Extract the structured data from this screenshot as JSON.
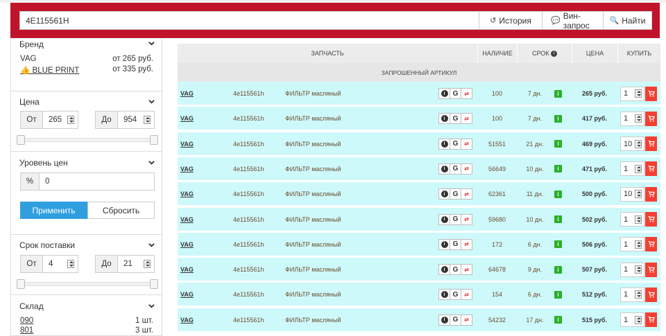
{
  "search": {
    "value": "4E115561H",
    "history": "История",
    "vin": "Вин-запрос",
    "find": "Найти"
  },
  "filters": {
    "brand": {
      "title": "Бренд",
      "items": [
        {
          "name": "VAG",
          "price": "от 265 руб."
        },
        {
          "name": "BLUE PRINT",
          "price": "от 335 руб."
        }
      ]
    },
    "price": {
      "title": "Цена",
      "from_label": "От",
      "from": "265",
      "to_label": "До",
      "to": "954"
    },
    "level": {
      "title": "Уровень цен",
      "pct_label": "%",
      "value": "0",
      "apply": "Применить",
      "reset": "Сбросить"
    },
    "delivery": {
      "title": "Срок поставки",
      "from_label": "От",
      "from": "4",
      "to_label": "До",
      "to": "21"
    },
    "warehouse": {
      "title": "Склад",
      "items": [
        {
          "name": "090",
          "count": "1 шт."
        },
        {
          "name": "801",
          "count": "3 шт."
        }
      ]
    }
  },
  "table": {
    "headers": {
      "part": "ЗАПЧАСТЬ",
      "avail": "НАЛИЧИЕ",
      "term": "СРОК",
      "price": "ЦЕНА",
      "buy": "КУПИТЬ"
    },
    "subheader": "ЗАПРОШЕННЫЙ АРТИКУЛ",
    "rows": [
      {
        "brand": "VAG",
        "art": "4e115561h",
        "desc": "ФИЛЬТР масляный",
        "qty": "100",
        "term": "7 дн.",
        "price": "265 руб.",
        "buy": "1"
      },
      {
        "brand": "VAG",
        "art": "4e115561h",
        "desc": "ФИЛЬТР масляный",
        "qty": "100",
        "term": "7 дн.",
        "price": "417 руб.",
        "buy": "1"
      },
      {
        "brand": "VAG",
        "art": "4e115561h",
        "desc": "ФИЛЬТР масляный",
        "qty": "51551",
        "term": "21 дн.",
        "price": "469 руб.",
        "buy": "10"
      },
      {
        "brand": "VAG",
        "art": "4e115561h",
        "desc": "ФИЛЬТР масляный",
        "qty": "56649",
        "term": "10 дн.",
        "price": "471 руб.",
        "buy": "1"
      },
      {
        "brand": "VAG",
        "art": "4e115561h",
        "desc": "ФИЛЬТР масляный",
        "qty": "62361",
        "term": "11 дн.",
        "price": "500 руб.",
        "buy": "10"
      },
      {
        "brand": "VAG",
        "art": "4e115561h",
        "desc": "ФИЛЬТР масляный",
        "qty": "59680",
        "term": "10 дн.",
        "price": "502 руб.",
        "buy": "1"
      },
      {
        "brand": "VAG",
        "art": "4e115561h",
        "desc": "ФИЛЬТР масляный",
        "qty": "172",
        "term": "6 дн.",
        "price": "506 руб.",
        "buy": "1"
      },
      {
        "brand": "VAG",
        "art": "4e115561h",
        "desc": "ФИЛЬТР масляный",
        "qty": "64678",
        "term": "9 дн.",
        "price": "507 руб.",
        "buy": "1"
      },
      {
        "brand": "VAG",
        "art": "4e115561h",
        "desc": "ФИЛЬТР масляный",
        "qty": "154",
        "term": "6 дн.",
        "price": "512 руб.",
        "buy": "1"
      },
      {
        "brand": "VAG",
        "art": "4e115561h",
        "desc": "ФИЛЬТР масляный",
        "qty": "54232",
        "term": "17 дн.",
        "price": "515 руб.",
        "buy": "1"
      }
    ]
  }
}
